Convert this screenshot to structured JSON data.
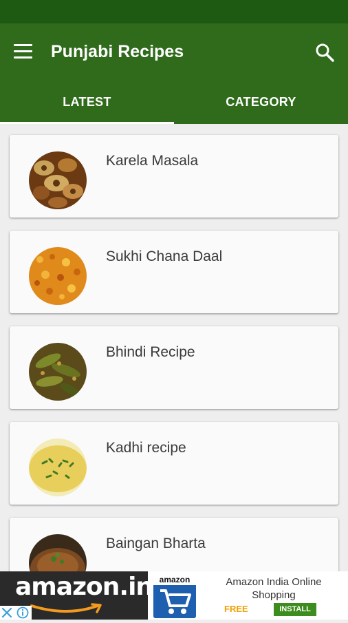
{
  "app": {
    "title": "Punjabi Recipes",
    "colors": {
      "status_bar": "#1e5a11",
      "app_bar": "#2f6b1b",
      "background": "#eeeeee",
      "card": "#fafafa",
      "install_button": "#3d8c1e"
    }
  },
  "toolbar": {
    "menu_icon": "hamburger-menu-icon",
    "search_icon": "search-icon"
  },
  "tabs": [
    {
      "label": "LATEST",
      "selected": true
    },
    {
      "label": "CATEGORY",
      "selected": false
    }
  ],
  "recipes": [
    {
      "title": "Karela Masala"
    },
    {
      "title": "Sukhi Chana Daal"
    },
    {
      "title": "Bhindi Recipe"
    },
    {
      "title": "Kadhi recipe"
    },
    {
      "title": "Baingan Bharta"
    }
  ],
  "ad": {
    "brand_logo": "amazon.in",
    "app_icon_label": "amazon",
    "title": "Amazon India Online Shopping",
    "price": "FREE",
    "install_label": "INSTALL"
  }
}
